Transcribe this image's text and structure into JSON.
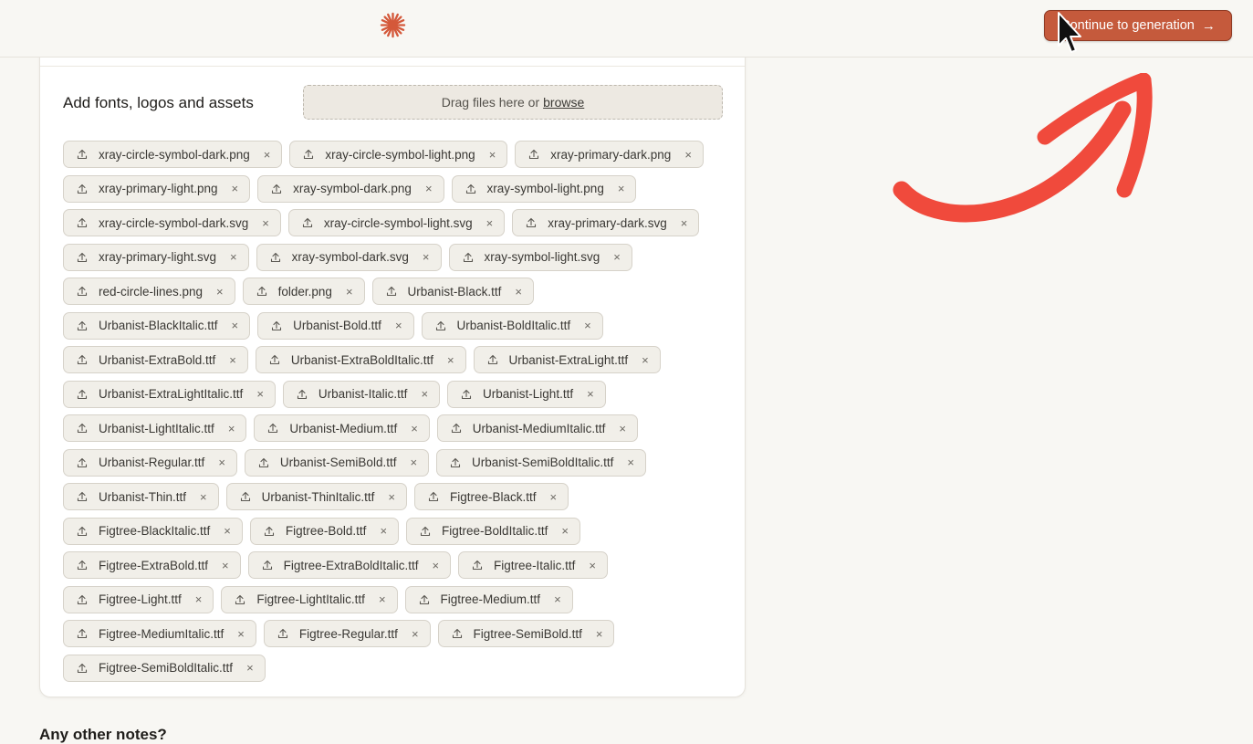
{
  "header": {
    "continue_label": "Continue to generation",
    "continue_icon": "→"
  },
  "assets": {
    "title": "Add fonts, logos and assets",
    "drop_text": "Drag files here or",
    "browse_label": "browse",
    "remove_glyph": "×",
    "files": [
      "xray-circle-symbol-dark.png",
      "xray-circle-symbol-light.png",
      "xray-primary-dark.png",
      "xray-primary-light.png",
      "xray-symbol-dark.png",
      "xray-symbol-light.png",
      "xray-circle-symbol-dark.svg",
      "xray-circle-symbol-light.svg",
      "xray-primary-dark.svg",
      "xray-primary-light.svg",
      "xray-symbol-dark.svg",
      "xray-symbol-light.svg",
      "red-circle-lines.png",
      "folder.png",
      "Urbanist-Black.ttf",
      "Urbanist-BlackItalic.ttf",
      "Urbanist-Bold.ttf",
      "Urbanist-BoldItalic.ttf",
      "Urbanist-ExtraBold.ttf",
      "Urbanist-ExtraBoldItalic.ttf",
      "Urbanist-ExtraLight.ttf",
      "Urbanist-ExtraLightItalic.ttf",
      "Urbanist-Italic.ttf",
      "Urbanist-Light.ttf",
      "Urbanist-LightItalic.ttf",
      "Urbanist-Medium.ttf",
      "Urbanist-MediumItalic.ttf",
      "Urbanist-Regular.ttf",
      "Urbanist-SemiBold.ttf",
      "Urbanist-SemiBoldItalic.ttf",
      "Urbanist-Thin.ttf",
      "Urbanist-ThinItalic.ttf",
      "Figtree-Black.ttf",
      "Figtree-BlackItalic.ttf",
      "Figtree-Bold.ttf",
      "Figtree-BoldItalic.ttf",
      "Figtree-ExtraBold.ttf",
      "Figtree-ExtraBoldItalic.ttf",
      "Figtree-Italic.ttf",
      "Figtree-Light.ttf",
      "Figtree-LightItalic.ttf",
      "Figtree-Medium.ttf",
      "Figtree-MediumItalic.ttf",
      "Figtree-Regular.ttf",
      "Figtree-SemiBold.ttf",
      "Figtree-SemiBoldItalic.ttf"
    ]
  },
  "notes": {
    "label": "Any other notes?"
  },
  "colors": {
    "accent": "#c55a3c",
    "annotation": "#f04a3c",
    "background": "#f8f7f3"
  }
}
